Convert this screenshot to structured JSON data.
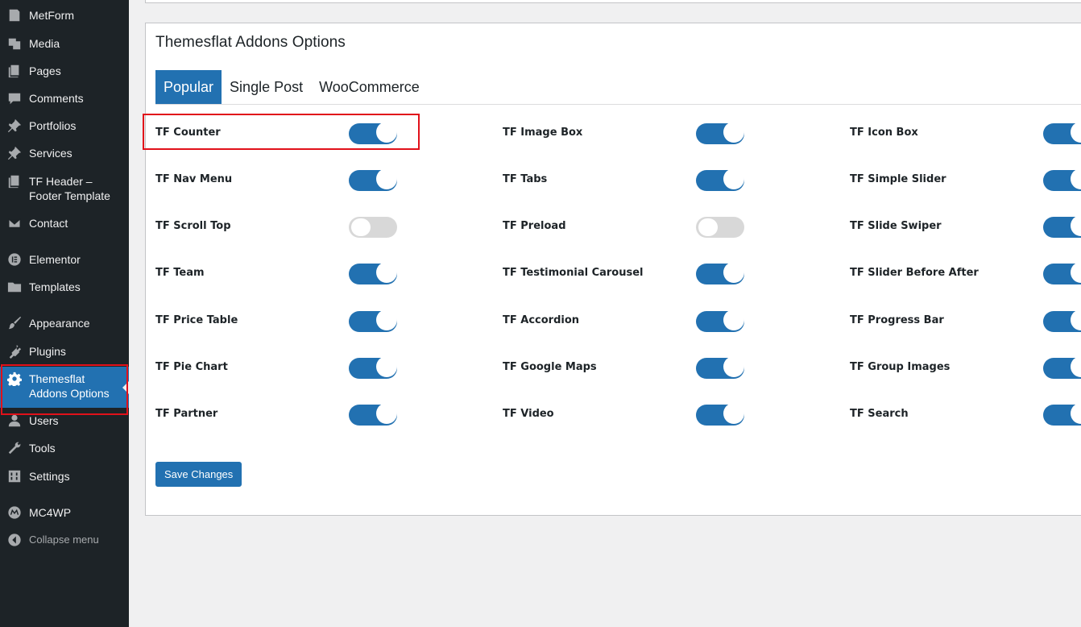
{
  "sidebar": {
    "items": [
      {
        "label": "MetForm",
        "icon": "form-icon"
      },
      {
        "label": "Media",
        "icon": "media-icon"
      },
      {
        "label": "Pages",
        "icon": "pages-icon"
      },
      {
        "label": "Comments",
        "icon": "comments-icon"
      },
      {
        "label": "Portfolios",
        "icon": "pin-icon"
      },
      {
        "label": "Services",
        "icon": "pin-icon"
      },
      {
        "label": "TF Header –",
        "label2": "Footer Template",
        "icon": "pages-icon"
      },
      {
        "label": "Contact",
        "icon": "mail-icon"
      },
      {
        "label": "Elementor",
        "icon": "elementor-icon"
      },
      {
        "label": "Templates",
        "icon": "folder-icon"
      },
      {
        "label": "Appearance",
        "icon": "brush-icon"
      },
      {
        "label": "Plugins",
        "icon": "plugin-icon"
      },
      {
        "label": "Themesflat",
        "label2": "Addons Options",
        "icon": "gear-icon"
      },
      {
        "label": "Users",
        "icon": "user-icon"
      },
      {
        "label": "Tools",
        "icon": "wrench-icon"
      },
      {
        "label": "Settings",
        "icon": "settings-icon"
      },
      {
        "label": "MC4WP",
        "icon": "mc4wp-icon"
      },
      {
        "label": "Collapse menu",
        "icon": "collapse-icon"
      }
    ]
  },
  "main": {
    "title": "Themesflat Addons Options",
    "tabs": [
      {
        "label": "Popular",
        "active": true
      },
      {
        "label": "Single Post",
        "active": false
      },
      {
        "label": "WooCommerce",
        "active": false
      }
    ],
    "options": [
      [
        {
          "label": "TF Counter",
          "enabled": true
        },
        {
          "label": "TF Nav Menu",
          "enabled": true
        },
        {
          "label": "TF Scroll Top",
          "enabled": false
        },
        {
          "label": "TF Team",
          "enabled": true
        },
        {
          "label": "TF Price Table",
          "enabled": true
        },
        {
          "label": "TF Pie Chart",
          "enabled": true
        },
        {
          "label": "TF Partner",
          "enabled": true
        }
      ],
      [
        {
          "label": "TF Image Box",
          "enabled": true
        },
        {
          "label": "TF Tabs",
          "enabled": true
        },
        {
          "label": "TF Preload",
          "enabled": false
        },
        {
          "label": "TF Testimonial Carousel",
          "enabled": true
        },
        {
          "label": "TF Accordion",
          "enabled": true
        },
        {
          "label": "TF Google Maps",
          "enabled": true
        },
        {
          "label": "TF Video",
          "enabled": true
        }
      ],
      [
        {
          "label": "TF Icon Box",
          "enabled": true
        },
        {
          "label": "TF Simple Slider",
          "enabled": true
        },
        {
          "label": "TF Slide Swiper",
          "enabled": true
        },
        {
          "label": "TF Slider Before After",
          "enabled": true
        },
        {
          "label": "TF Progress Bar",
          "enabled": true
        },
        {
          "label": "TF Group Images",
          "enabled": true
        },
        {
          "label": "TF Search",
          "enabled": true
        }
      ]
    ],
    "save_label": "Save Changes"
  },
  "colors": {
    "sidebar_bg": "#1d2327",
    "accent": "#2271b1",
    "highlight": "#e1111a",
    "toggle_off": "#d8d8d8"
  }
}
